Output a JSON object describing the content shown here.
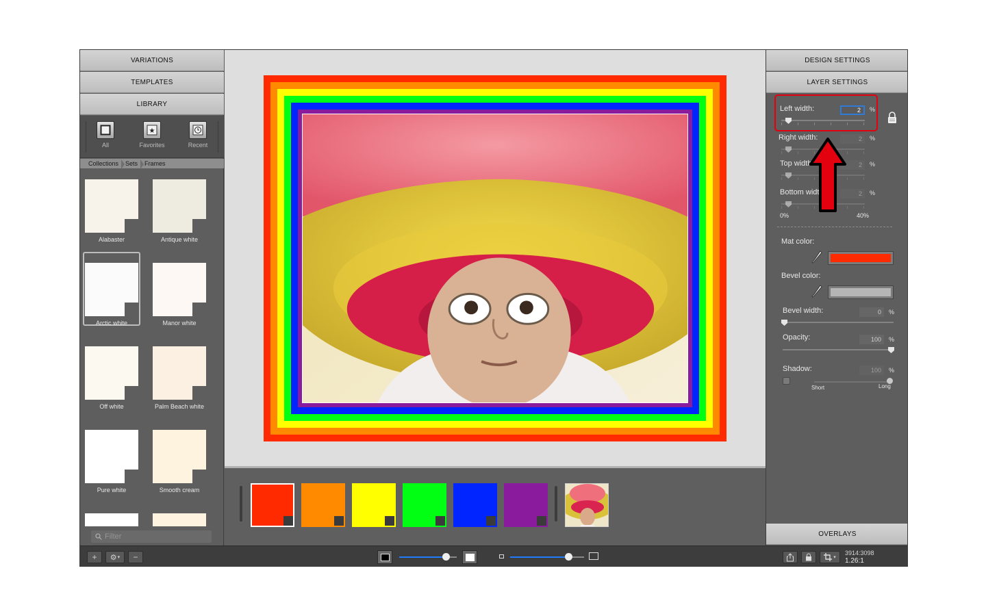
{
  "left_panel": {
    "tabs": [
      "VARIATIONS",
      "TEMPLATES",
      "LIBRARY"
    ],
    "library_buttons": [
      {
        "label": "All",
        "icon": "frame-icon"
      },
      {
        "label": "Favorites",
        "icon": "star-icon"
      },
      {
        "label": "Recent",
        "icon": "clock-icon"
      }
    ],
    "breadcrumb": [
      "Collections",
      "Sets",
      "Frames"
    ],
    "swatches": [
      {
        "name": "Alabaster",
        "color": "#f8f3ea"
      },
      {
        "name": "Antique white",
        "color": "#eeebe1"
      },
      {
        "name": "Arctic white",
        "color": "#fbfbfb",
        "selected": true
      },
      {
        "name": "Manor white",
        "color": "#fdf8f3"
      },
      {
        "name": "Off white",
        "color": "#fcf9f1"
      },
      {
        "name": "Palm Beach white",
        "color": "#fbf0e2"
      },
      {
        "name": "Pure white",
        "color": "#ffffff"
      },
      {
        "name": "Smooth cream",
        "color": "#fdf3df"
      },
      {
        "name": "",
        "color": "#ffffff"
      },
      {
        "name": "",
        "color": "#fdf3df"
      }
    ],
    "filter_placeholder": "Filter"
  },
  "strip": {
    "colors": [
      "#ff2a00",
      "#ff8a00",
      "#ffff00",
      "#00ff12",
      "#0025ff",
      "#8a1b9c"
    ],
    "active_index": 0
  },
  "frame_rings": [
    "#ff2a00",
    "#ff8a00",
    "#ffff00",
    "#00ff12",
    "#0025ff",
    "#8a1b9c"
  ],
  "right_panel": {
    "tabs": {
      "design": "DESIGN SETTINGS",
      "layer": "LAYER SETTINGS",
      "overlays": "OVERLAYS"
    },
    "widths": [
      {
        "label": "Left width:",
        "value": "2",
        "unit": "%"
      },
      {
        "label": "Right width:",
        "value": "2",
        "unit": "%"
      },
      {
        "label": "Top width:",
        "value": "2",
        "unit": "%"
      },
      {
        "label": "Bottom width:",
        "value": "2",
        "unit": "%"
      }
    ],
    "range_min": "0%",
    "range_max": "40%",
    "mat_color": {
      "label": "Mat color:",
      "color": "#ff2a00"
    },
    "bevel_color": {
      "label": "Bevel color:",
      "color": "#b5b5b5"
    },
    "bevel_width": {
      "label": "Bevel width:",
      "value": "0",
      "unit": "%"
    },
    "opacity": {
      "label": "Opacity:",
      "value": "100",
      "unit": "%"
    },
    "shadow": {
      "label": "Shadow:",
      "value": "100",
      "unit": "%",
      "short": "Short",
      "long": "Long"
    }
  },
  "toolbar": {
    "add": "+",
    "remove": "−",
    "gear": "⚙",
    "dimensions": "3914:3098",
    "ratio": "1.26:1"
  }
}
